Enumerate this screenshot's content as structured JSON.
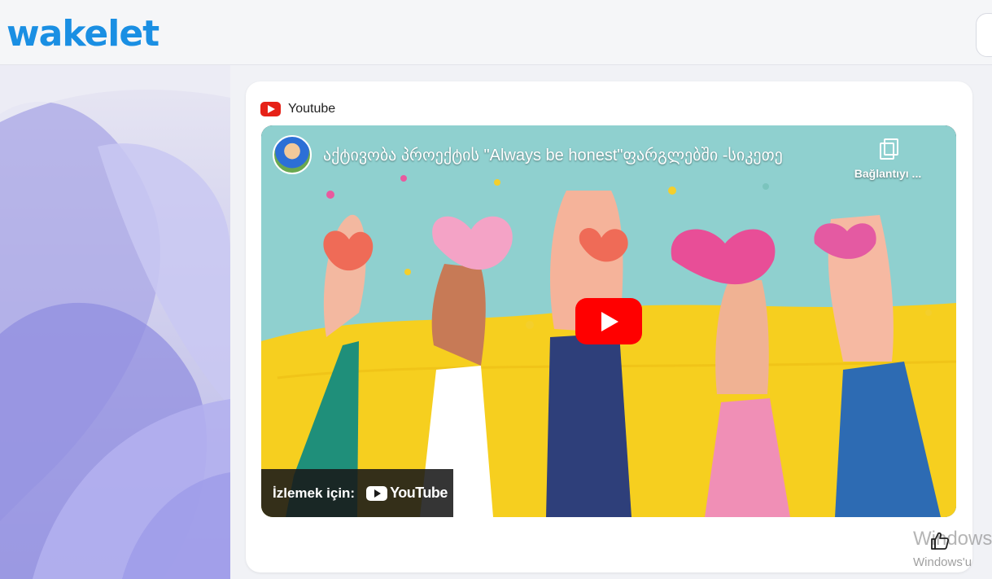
{
  "app": {
    "logo_text": "wakelet",
    "brand_color": "#1a8fe3"
  },
  "card": {
    "source_label": "Youtube",
    "source_icon": "youtube-icon"
  },
  "video": {
    "title": "აქტივობა პროექტის \"Always be honest\"ფარგლებში -სიკეთე",
    "copy_link_label": "Bağlantıyı ...",
    "watch_on_label": "İzlemek için:",
    "youtube_logo_text": "YouTube",
    "play_button_color": "#ff0000"
  },
  "actions": {
    "like_icon": "thumbs-up-icon"
  },
  "watermark": {
    "line1": "Windows",
    "line2": "Windows'u"
  }
}
